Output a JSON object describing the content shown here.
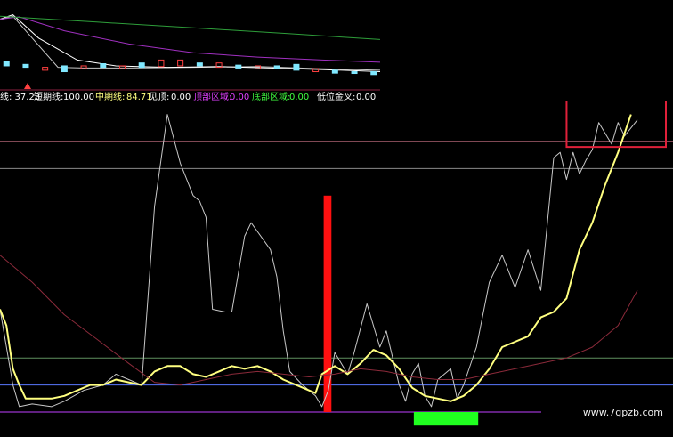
{
  "readout": {
    "partial_label": "线: 37.23",
    "short_label": "短期线:",
    "short_value": "100.00",
    "mid_label": "中期线:",
    "mid_value": "84.71",
    "top_signal_label": "见顶:",
    "top_signal_value": "0.00",
    "top_zone_label": "顶部区域:",
    "top_zone_value": "0.00",
    "bottom_zone_label": "底部区域:",
    "bottom_zone_value": "0.00",
    "low_cross_label": "低位金叉:",
    "low_cross_value": "0.00"
  },
  "watermark": "www.7gpzb.com",
  "colors": {
    "background": "#000000",
    "white_line": "#c8c8c8",
    "yellow_line": "#ffff80",
    "maroon_line": "#8b2a3a",
    "level_pink": "#ff8fa8",
    "level_gray": "#8a8a8a",
    "level_green": "#5f8f5f",
    "level_blue": "#5a78ff",
    "level_purple": "#c040ff",
    "signal_red": "#ff1010",
    "signal_green": "#20ff20",
    "top_zone_box": "#e0203a",
    "thumb_green": "#2e9e3a",
    "thumb_purple": "#a030c0",
    "thumb_cyan": "#80e8ff",
    "thumb_red": "#ff4040"
  },
  "chart_data": [
    {
      "type": "line",
      "panel": "main-indicator",
      "title": "",
      "xlabel": "",
      "ylabel": "",
      "x_count": 100,
      "ylim": [
        0,
        105
      ],
      "grid": false,
      "levels": [
        {
          "name": "",
          "value": 100,
          "color": "#ff8fa8"
        },
        {
          "name": "",
          "value": 90,
          "color": "#8a8a8a"
        },
        {
          "name": "",
          "value": 20,
          "color": "#5f8f5f"
        },
        {
          "name": "",
          "value": 10,
          "color": "#5a78ff"
        },
        {
          "name": "",
          "value": 0,
          "color": "#c040ff"
        }
      ],
      "series": [
        {
          "key": "white",
          "color": "#c8c8c8",
          "points": [
            [
              0,
              38
            ],
            [
              2,
              10
            ],
            [
              3,
              2
            ],
            [
              5,
              3
            ],
            [
              8,
              2
            ],
            [
              10,
              4
            ],
            [
              13,
              8
            ],
            [
              16,
              10
            ],
            [
              18,
              14
            ],
            [
              20,
              12
            ],
            [
              22,
              10
            ],
            [
              24,
              76
            ],
            [
              26,
              110
            ],
            [
              28,
              92
            ],
            [
              30,
              80
            ],
            [
              31,
              78
            ],
            [
              32,
              72
            ],
            [
              33,
              38
            ],
            [
              35,
              37
            ],
            [
              36,
              37
            ],
            [
              38,
              65
            ],
            [
              39,
              70
            ],
            [
              42,
              60
            ],
            [
              43,
              50
            ],
            [
              44,
              30
            ],
            [
              45,
              15
            ],
            [
              47,
              10
            ],
            [
              49,
              6
            ],
            [
              50,
              2
            ],
            [
              51,
              8
            ],
            [
              52,
              22
            ],
            [
              54,
              14
            ],
            [
              55,
              22
            ],
            [
              57,
              40
            ],
            [
              59,
              24
            ],
            [
              60,
              30
            ],
            [
              62,
              10
            ],
            [
              63,
              4
            ],
            [
              64,
              14
            ],
            [
              65,
              18
            ],
            [
              66,
              6
            ],
            [
              67,
              2
            ],
            [
              68,
              12
            ],
            [
              70,
              16
            ],
            [
              71,
              5
            ],
            [
              72,
              10
            ],
            [
              74,
              24
            ],
            [
              76,
              48
            ],
            [
              78,
              58
            ],
            [
              80,
              46
            ],
            [
              82,
              60
            ],
            [
              84,
              45
            ],
            [
              86,
              94
            ],
            [
              87,
              96
            ],
            [
              88,
              86
            ],
            [
              89,
              96
            ],
            [
              90,
              88
            ],
            [
              91,
              93
            ],
            [
              92,
              97
            ],
            [
              93,
              107
            ],
            [
              95,
              99
            ],
            [
              96,
              107
            ],
            [
              97,
              102
            ],
            [
              99,
              108
            ]
          ]
        },
        {
          "key": "yellow",
          "color": "#ffff80",
          "points": [
            [
              0,
              38
            ],
            [
              1,
              32
            ],
            [
              2,
              16
            ],
            [
              3,
              10
            ],
            [
              4,
              5
            ],
            [
              6,
              5
            ],
            [
              8,
              5
            ],
            [
              10,
              6
            ],
            [
              12,
              8
            ],
            [
              14,
              10
            ],
            [
              16,
              10
            ],
            [
              18,
              12
            ],
            [
              20,
              11
            ],
            [
              22,
              10
            ],
            [
              24,
              15
            ],
            [
              26,
              17
            ],
            [
              28,
              17
            ],
            [
              30,
              14
            ],
            [
              32,
              13
            ],
            [
              34,
              15
            ],
            [
              36,
              17
            ],
            [
              38,
              16
            ],
            [
              40,
              17
            ],
            [
              42,
              15
            ],
            [
              44,
              12
            ],
            [
              46,
              10
            ],
            [
              48,
              8
            ],
            [
              49,
              7
            ],
            [
              50,
              14
            ],
            [
              52,
              17
            ],
            [
              54,
              14
            ],
            [
              56,
              18
            ],
            [
              58,
              23
            ],
            [
              60,
              21
            ],
            [
              62,
              16
            ],
            [
              64,
              9
            ],
            [
              66,
              6
            ],
            [
              68,
              5
            ],
            [
              70,
              4
            ],
            [
              72,
              6
            ],
            [
              74,
              10
            ],
            [
              76,
              16
            ],
            [
              78,
              24
            ],
            [
              80,
              26
            ],
            [
              82,
              28
            ],
            [
              84,
              35
            ],
            [
              86,
              37
            ],
            [
              88,
              42
            ],
            [
              90,
              60
            ],
            [
              92,
              70
            ],
            [
              94,
              84
            ],
            [
              96,
              96
            ],
            [
              98,
              110
            ]
          ]
        },
        {
          "key": "maroon",
          "color": "#8b2a3a",
          "points": [
            [
              0,
              58
            ],
            [
              5,
              48
            ],
            [
              10,
              36
            ],
            [
              15,
              27
            ],
            [
              20,
              18
            ],
            [
              24,
              11
            ],
            [
              28,
              10
            ],
            [
              32,
              12
            ],
            [
              36,
              14
            ],
            [
              40,
              15
            ],
            [
              44,
              14
            ],
            [
              48,
              13
            ],
            [
              52,
              14
            ],
            [
              56,
              16
            ],
            [
              60,
              15
            ],
            [
              64,
              13
            ],
            [
              68,
              12
            ],
            [
              72,
              12
            ],
            [
              76,
              14
            ],
            [
              80,
              16
            ],
            [
              84,
              18
            ],
            [
              88,
              20
            ],
            [
              92,
              24
            ],
            [
              96,
              32
            ],
            [
              99,
              45
            ]
          ]
        }
      ],
      "bars": [
        {
          "name": "",
          "color": "#ff1010",
          "x0": 50,
          "x1": 51,
          "y0": 0,
          "y1": 80
        },
        {
          "name": "",
          "color": "#20ff20",
          "x0": 64,
          "x1": 74,
          "y0": -5,
          "y1": 0
        }
      ]
    },
    {
      "type": "line",
      "panel": "thumbnail-candles",
      "title": "",
      "xlabel": "",
      "ylabel": "",
      "x_count": 60,
      "ylim": [
        0,
        100
      ],
      "grid": false,
      "series": [
        {
          "key": "thumb-gray",
          "color": "#c8c8c8",
          "points": [
            [
              0,
              85
            ],
            [
              2,
              90
            ],
            [
              5,
              60
            ],
            [
              9,
              20
            ],
            [
              13,
              19
            ],
            [
              20,
              19
            ],
            [
              30,
              20
            ],
            [
              40,
              21
            ],
            [
              50,
              18
            ],
            [
              59,
              16
            ]
          ]
        },
        {
          "key": "thumb-white",
          "color": "#ffffff",
          "points": [
            [
              0,
              86
            ],
            [
              2,
              92
            ],
            [
              6,
              60
            ],
            [
              12,
              30
            ],
            [
              18,
              22
            ],
            [
              26,
              20
            ],
            [
              34,
              21
            ],
            [
              42,
              19
            ],
            [
              50,
              17
            ],
            [
              59,
              14
            ]
          ]
        },
        {
          "key": "thumb-purple",
          "color": "#a030c0",
          "points": [
            [
              0,
              86
            ],
            [
              3,
              89
            ],
            [
              10,
              70
            ],
            [
              20,
              52
            ],
            [
              30,
              40
            ],
            [
              40,
              34
            ],
            [
              50,
              30
            ],
            [
              59,
              27
            ]
          ]
        },
        {
          "key": "thumb-green",
          "color": "#2e9e3a",
          "points": [
            [
              0,
              90
            ],
            [
              15,
              82
            ],
            [
              30,
              74
            ],
            [
              45,
              66
            ],
            [
              59,
              58
            ]
          ]
        }
      ],
      "candles": [
        [
          1,
          22,
          28,
          "#80e8ff"
        ],
        [
          4,
          20,
          24,
          "#80e8ff"
        ],
        [
          7,
          16,
          20,
          "#ff4040"
        ],
        [
          10,
          14,
          22,
          "#80e8ff"
        ],
        [
          13,
          18,
          22,
          "#ff4040"
        ],
        [
          16,
          20,
          25,
          "#80e8ff"
        ],
        [
          19,
          18,
          22,
          "#ff4040"
        ],
        [
          22,
          20,
          26,
          "#80e8ff"
        ],
        [
          25,
          21,
          30,
          "#ff4040"
        ],
        [
          28,
          22,
          30,
          "#ff4040"
        ],
        [
          31,
          22,
          26,
          "#80e8ff"
        ],
        [
          34,
          20,
          26,
          "#ff4040"
        ],
        [
          37,
          19,
          23,
          "#80e8ff"
        ],
        [
          40,
          18,
          22,
          "#ff4040"
        ],
        [
          43,
          18,
          22,
          "#80e8ff"
        ],
        [
          46,
          16,
          24,
          "#80e8ff"
        ],
        [
          49,
          14,
          18,
          "#ff4040"
        ],
        [
          52,
          12,
          16,
          "#80e8ff"
        ],
        [
          55,
          12,
          14,
          "#80e8ff"
        ],
        [
          58,
          10,
          14,
          "#80e8ff"
        ]
      ]
    }
  ]
}
